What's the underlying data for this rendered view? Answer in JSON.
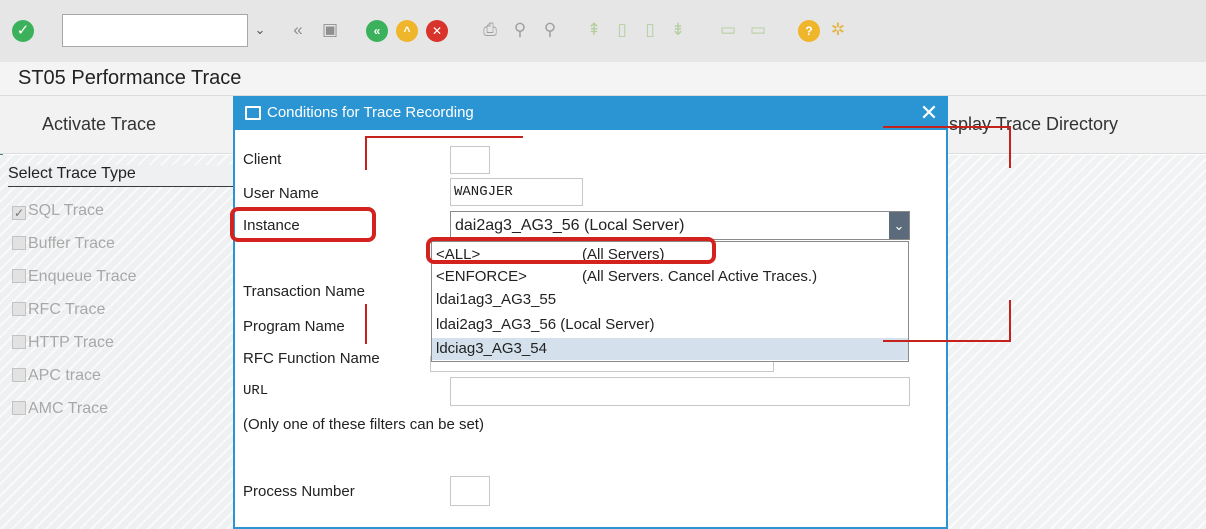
{
  "toolbar": {
    "ok_icon": "check-circle-icon",
    "command_field_value": "",
    "icons": [
      "back-icon",
      "save-icon",
      "back-circle-icon",
      "exit-circle-icon",
      "cancel-circle-icon",
      "print-icon",
      "find-icon",
      "find-next-icon",
      "first-page-icon",
      "previous-page-icon",
      "next-page-icon",
      "last-page-icon",
      "create-session-icon",
      "shortcut-icon",
      "help-icon",
      "settings-icon"
    ],
    "colors": {
      "ok": "#3ab15a",
      "back": "#3ab15a",
      "exit": "#f0b62b",
      "cancel": "#d9342b",
      "help": "#f0b62b"
    }
  },
  "title": "ST05 Performance Trace",
  "app_toolbar": {
    "activate_label": "Activate Trace",
    "directory_label": "isplay Trace Directory"
  },
  "side": {
    "header": "Select Trace Type",
    "items": [
      {
        "label": "SQL Trace",
        "checked": true
      },
      {
        "label": "Buffer Trace",
        "checked": false
      },
      {
        "label": "Enqueue Trace",
        "checked": false
      },
      {
        "label": "RFC Trace",
        "checked": false
      },
      {
        "label": "HTTP Trace",
        "checked": false
      },
      {
        "label": "APC trace",
        "checked": false
      },
      {
        "label": "AMC Trace",
        "checked": false
      }
    ]
  },
  "dialog": {
    "title": "Conditions for Trace Recording",
    "close_glyph": "✕",
    "labels": {
      "client": "Client",
      "user": "User Name",
      "instance": "Instance",
      "transaction": "Transaction Name",
      "program": "Program Name",
      "rfc": "RFC Function Name",
      "url": "URL",
      "note": "(Only one of these filters can be set)",
      "process": "Process Number"
    },
    "values": {
      "client": "",
      "user": "WANGJER",
      "instance": "dai2ag3_AG3_56 (Local Server)",
      "url": "",
      "process": ""
    },
    "instance_options": [
      {
        "key": "<ALL>",
        "desc": "(All Servers)"
      },
      {
        "key": "<ENFORCE>",
        "desc": "(All Servers. Cancel Active Traces.)"
      },
      {
        "key": "ldai1ag3_AG3_55",
        "desc": ""
      },
      {
        "key": "ldai2ag3_AG3_56 (Local Server)",
        "desc": ""
      },
      {
        "key": "ldciag3_AG3_54",
        "desc": ""
      }
    ],
    "selected_option": "ldciag3_AG3_54"
  },
  "colors": {
    "dialog_accent": "#2b95d4",
    "highlight": "#d4221e"
  }
}
